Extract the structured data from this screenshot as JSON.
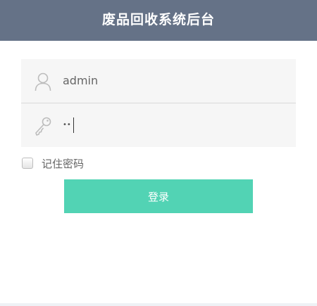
{
  "header": {
    "title": "废品回收系统后台"
  },
  "login_form": {
    "username": {
      "value": "admin",
      "icon": "user-icon"
    },
    "password": {
      "masked_value": "••",
      "icon": "key-icon"
    },
    "remember_label": "记住密码",
    "remember_checked": false,
    "submit_label": "登录"
  },
  "colors": {
    "header_bg": "#657287",
    "button_bg": "#52d3b4",
    "field_bg": "#f6f6f6"
  }
}
